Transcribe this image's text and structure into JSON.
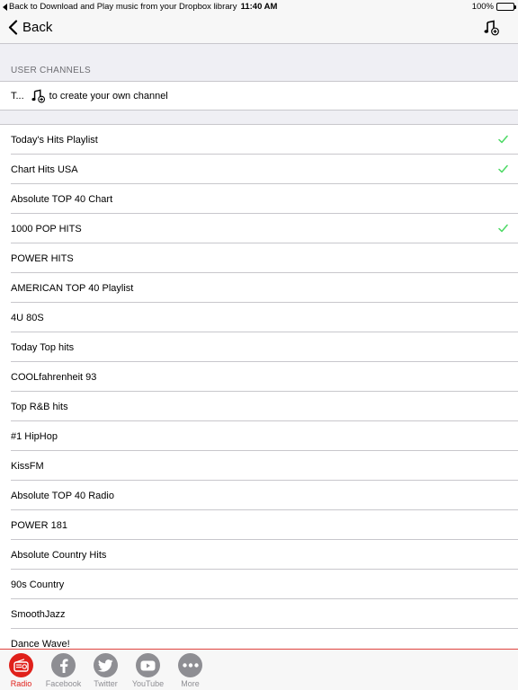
{
  "status_bar": {
    "back_app": "Back to Download and Play music from your Dropbox library",
    "time": "11:40 AM",
    "battery": "100%",
    "battery_level": 1.0
  },
  "nav": {
    "back_label": "Back",
    "add_icon": "music-note-add-icon"
  },
  "user_channels": {
    "header": "USER CHANNELS",
    "hint_prefix": "T...",
    "hint_icon": "music-note-add-icon",
    "hint_suffix": "to create your own channel"
  },
  "channels": [
    {
      "name": "Today's Hits Playlist",
      "checked": true
    },
    {
      "name": "Chart Hits USA",
      "checked": true
    },
    {
      "name": "Absolute TOP 40 Chart",
      "checked": false
    },
    {
      "name": "1000 POP HITS",
      "checked": true
    },
    {
      "name": "POWER HITS",
      "checked": false
    },
    {
      "name": "AMERICAN TOP 40 Playlist",
      "checked": false
    },
    {
      "name": "4U 80S",
      "checked": false
    },
    {
      "name": "Today Top hits",
      "checked": false
    },
    {
      "name": "COOLfahrenheit 93",
      "checked": false
    },
    {
      "name": "Top R&B hits",
      "checked": false
    },
    {
      "name": "#1  HipHop",
      "checked": false
    },
    {
      "name": "KissFM",
      "checked": false
    },
    {
      "name": "Absolute TOP 40 Radio",
      "checked": false
    },
    {
      "name": "POWER 181",
      "checked": false
    },
    {
      "name": "Absolute Country Hits",
      "checked": false
    },
    {
      "name": "90s Country",
      "checked": false
    },
    {
      "name": "SmoothJazz",
      "checked": false
    },
    {
      "name": "Dance Wave!",
      "checked": false
    }
  ],
  "tabs": [
    {
      "label": "Radio",
      "icon": "radio-icon",
      "active": true
    },
    {
      "label": "Facebook",
      "icon": "facebook-icon",
      "active": false
    },
    {
      "label": "Twitter",
      "icon": "twitter-icon",
      "active": false
    },
    {
      "label": "YouTube",
      "icon": "youtube-icon",
      "active": false
    },
    {
      "label": "More",
      "icon": "more-dots-icon",
      "active": false
    }
  ],
  "colors": {
    "accent": "#e0211b",
    "check": "#4cd964",
    "tab_inactive": "#8e8e93"
  }
}
